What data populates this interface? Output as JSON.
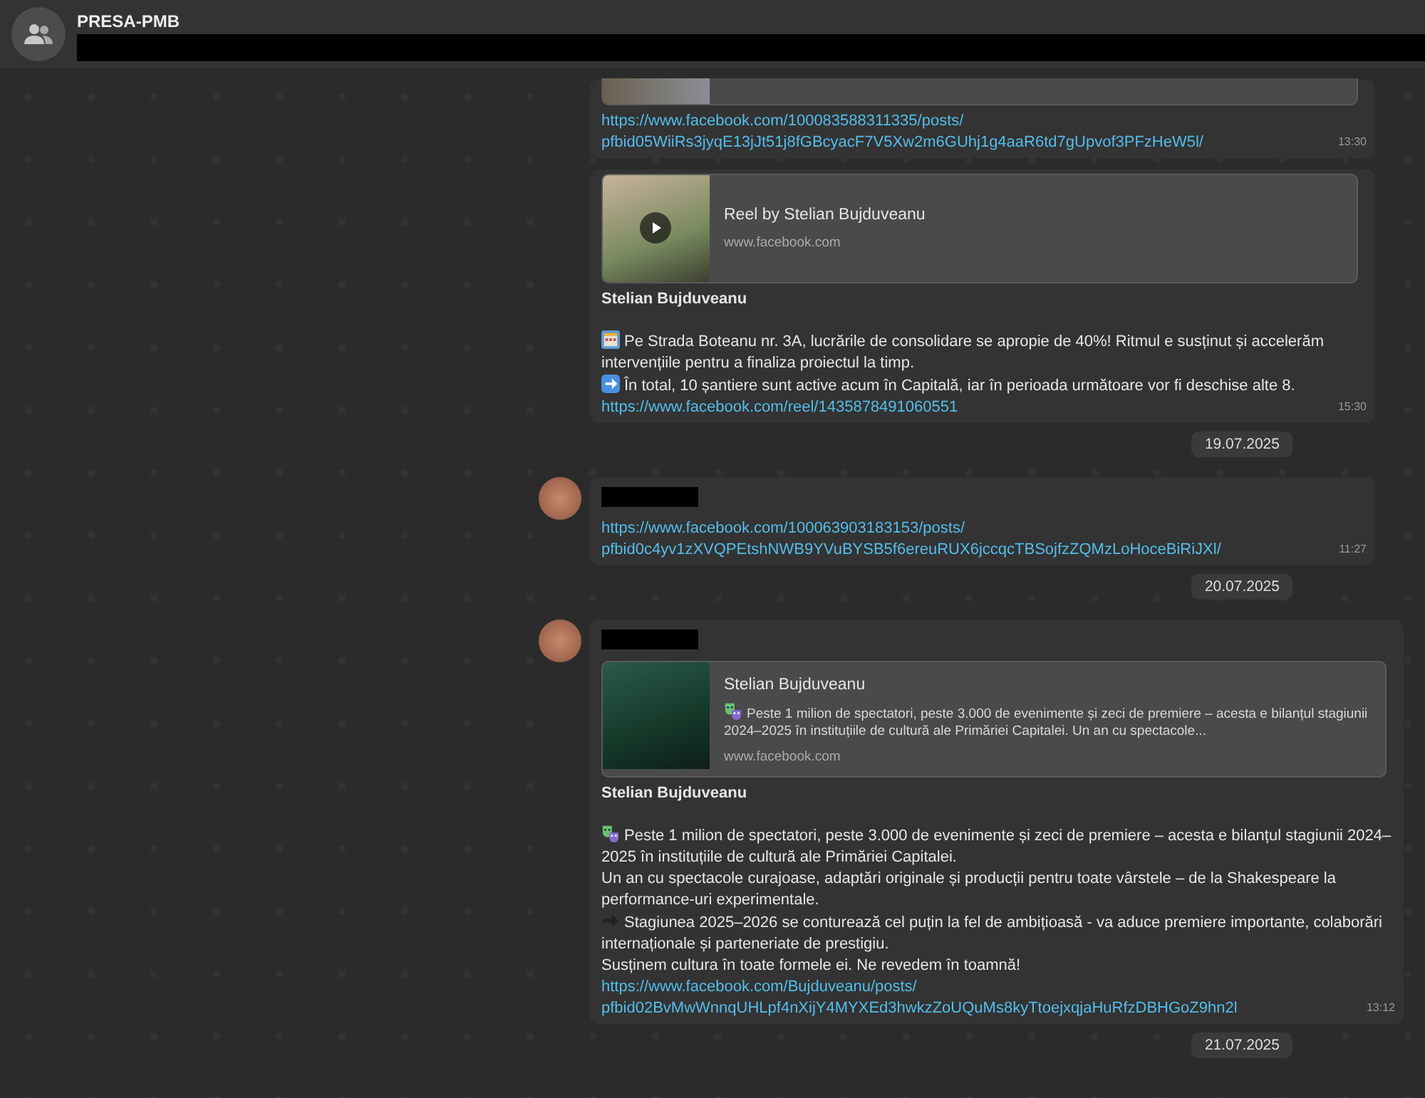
{
  "header": {
    "title": "PRESA-PMB"
  },
  "items": [
    {
      "kind": "continuation",
      "preview": {
        "kind": "clipped"
      },
      "link": [
        "https://www.facebook.com/100083588311335/posts/",
        "pfbid05WiiRs3jyqE13jJt51j8fGBcyacF7V5Xw2m6GUhj1g4aaR6td7gUpvof3PFzHeW5l/"
      ],
      "time": "13:30"
    },
    {
      "kind": "continuation",
      "preview": {
        "kind": "video",
        "title": "Reel by Stelian Bujduveanu",
        "site": "www.facebook.com"
      },
      "author": "Stelian Bujduveanu",
      "paragraphs": [
        {
          "kind": "emoji-line",
          "text": "Pe Strada Boteanu nr. 3A, lucrările de consolidare se apropie de 40%! Ritmul e susținut și accelerăm intervențiile pentru a finaliza proiectul la timp."
        },
        {
          "kind": "emoji-line",
          "text": "În total, 10 șantiere sunt active acum în Capitală, iar în perioada următoare vor fi deschise alte 8."
        }
      ],
      "link": [
        "https://www.facebook.com/reel/1435878491060551"
      ],
      "time": "15:30"
    },
    {
      "kind": "date",
      "text": "19.07.2025"
    },
    {
      "kind": "first",
      "link": [
        "https://www.facebook.com/100063903183153/posts/",
        "pfbid0c4yv1zXVQPEtshNWB9YVuBYSB5f6ereuRUX6jccqcTBSojfzZQMzLoHoceBiRiJXl/"
      ],
      "time": "11:27"
    },
    {
      "kind": "date",
      "text": "20.07.2025"
    },
    {
      "kind": "first",
      "preview": {
        "kind": "post",
        "title": "Stelian Bujduveanu",
        "desc": "Peste 1 milion de spectatori, peste 3.000 de evenimente și zeci de premiere – acesta e bilanțul stagiunii 2024–2025 în instituțiile de cultură ale Primăriei Capitalei.  Un an cu spectacole...",
        "site": "www.facebook.com"
      },
      "author": "Stelian Bujduveanu",
      "paragraphs": [
        {
          "kind": "emoji-line",
          "text": "Peste 1 milion de spectatori, peste 3.000 de evenimente și zeci de premiere – acesta e bilanțul stagiunii 2024–2025 în instituțiile de cultură ale Primăriei Capitalei."
        },
        {
          "kind": "plain",
          "text": "Un an cu spectacole curajoase, adaptări originale și producții pentru toate vârstele – de la Shakespeare la performance-uri experimentale."
        },
        {
          "kind": "emoji-line",
          "text": "Stagiunea 2025–2026 se conturează cel puțin la fel de ambițioasă - va aduce premiere importante, colaborări internaționale și parteneriate de prestigiu."
        },
        {
          "kind": "plain",
          "text": "Susținem cultura în toate formele ei. Ne revedem în toamnă!"
        }
      ],
      "link": [
        "https://www.facebook.com/Bujduveanu/posts/",
        "pfbid02BvMwWnnqUHLpf4nXijY4MYXEd3hwkzZoUQuMs8kyTtoejxqjaHuRfzDBHGoZ9hn2l"
      ],
      "time": "13:12"
    },
    {
      "kind": "date",
      "text": "21.07.2025"
    }
  ]
}
